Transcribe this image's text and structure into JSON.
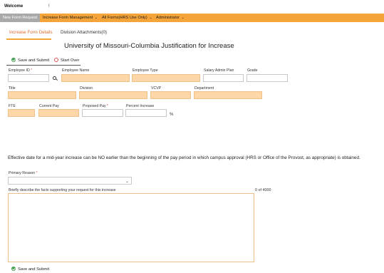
{
  "header": {
    "welcome": "Welcome",
    "user_mark": "!"
  },
  "nav": {
    "items": [
      {
        "label": "New Form Request",
        "active": true,
        "caret": ""
      },
      {
        "label": "Increase Form Management",
        "active": false,
        "caret": "⌄"
      },
      {
        "label": "All Forms(HRS Use Only)",
        "active": false,
        "caret": "⌄"
      },
      {
        "label": "Administrator",
        "active": false,
        "caret": "⌄"
      }
    ]
  },
  "tabs": [
    {
      "label": "Increase Form Details",
      "active": true
    },
    {
      "label": "Division Attachments(0)",
      "active": false
    }
  ],
  "page_title": "University of Missouri-Columbia Justification for Increase",
  "actions": {
    "save_submit": "Save and Submit",
    "start_over": "Start Over"
  },
  "form": {
    "row1": {
      "employee_id": {
        "label": "Employee ID",
        "required": "*"
      },
      "employee_name": {
        "label": "Employee Name"
      },
      "employee_type": {
        "label": "Employee Type"
      },
      "salary_admin_plan": {
        "label": "Salary Admin Plan"
      },
      "grade": {
        "label": "Grade"
      }
    },
    "row2": {
      "title": {
        "label": "Title"
      },
      "division": {
        "label": "Division"
      },
      "vcvp": {
        "label": "VCVP"
      },
      "department": {
        "label": "Department"
      }
    },
    "row3": {
      "fte": {
        "label": "FTE"
      },
      "current_pay": {
        "label": "Current Pay"
      },
      "proposed_pay": {
        "label": "Proposed Pay",
        "required": "*"
      },
      "percent_increase": {
        "label": "Percent Increase"
      },
      "percent_symbol": "%"
    }
  },
  "notice": "Effective date for a mid-year increase can be NO earlier than the beginning of the pay period in which campus approval (HRS or Office of the Provost, as appropriate) is obtained.",
  "primary_reason": {
    "label": "Primary Reason",
    "required": "*",
    "value": ""
  },
  "facts": {
    "label": "Briefly describe the facts supporting your request for this increase",
    "counter": "0 of 4000",
    "value": ""
  },
  "colors": {
    "nav_bg": "#f5a43a",
    "readonly_field": "#fdd7a8",
    "active_tab": "#e26a2c",
    "active_nav": "#a9a9a9"
  }
}
